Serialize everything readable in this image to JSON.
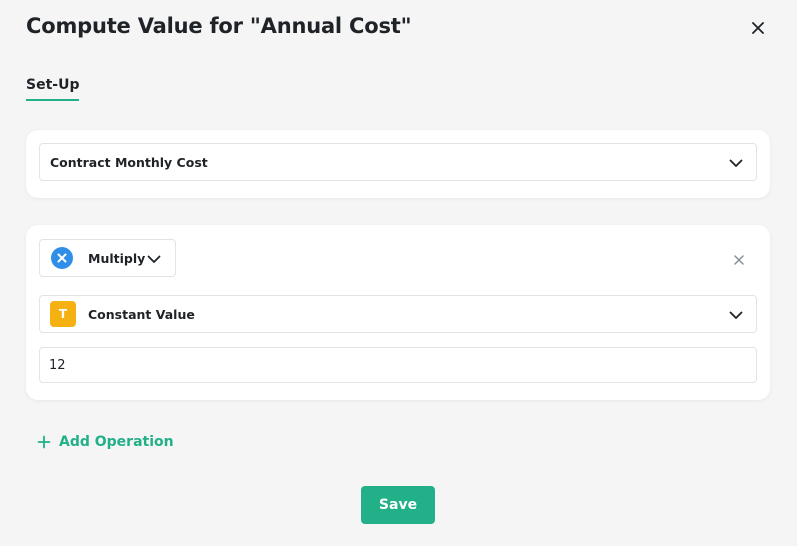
{
  "dialog": {
    "title": "Compute Value for \"Annual Cost\"",
    "close_icon": "close-icon"
  },
  "tabs": [
    {
      "label": "Set-Up",
      "active": true
    }
  ],
  "base_field": {
    "selected": "Contract Monthly Cost",
    "icon": "chevron-down-icon"
  },
  "operation": {
    "operator_label": "Multiply",
    "operator_icon": "multiply-icon",
    "operand_type_label": "Constant Value",
    "operand_type_icon": "text-type-icon",
    "operand_type_glyph": "T",
    "value": "12",
    "remove_icon": "close-icon"
  },
  "actions": {
    "add_operation_label": "Add Operation",
    "save_label": "Save"
  },
  "colors": {
    "accent": "#22b089",
    "operator_blue": "#2f8fe8",
    "type_yellow": "#f5b111",
    "background": "#f5f5f5"
  }
}
